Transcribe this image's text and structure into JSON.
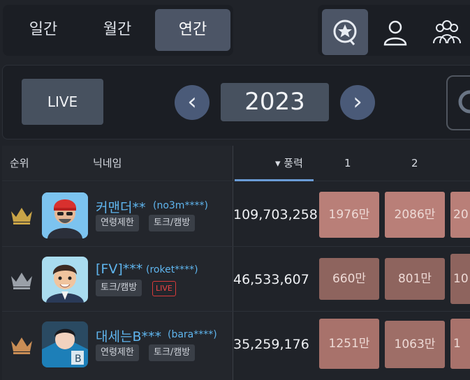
{
  "period_tabs": {
    "daily": "일간",
    "monthly": "월간",
    "yearly": "연간"
  },
  "view_icons": [
    "star-chat-icon",
    "user-icon",
    "group-icon"
  ],
  "controls": {
    "live_label": "LIVE",
    "prev": "‹",
    "year": "2023",
    "next": "›"
  },
  "table": {
    "headers": {
      "rank": "순위",
      "nickname": "닉네임",
      "power": "▾ 풍력",
      "col1": "1",
      "col2": "2"
    },
    "rows": [
      {
        "nickname": "커맨더**",
        "user_id": "(no3m****)",
        "tags": [
          "연령제한",
          "토크/캠방"
        ],
        "live": "",
        "power": "109,703,258",
        "m1": "1976만",
        "m2": "2086만",
        "m3": "20",
        "crown_color": "#c9a447"
      },
      {
        "nickname": "[FV]***",
        "user_id": "(roket****)",
        "tags": [
          "토크/캠방"
        ],
        "live": "LIVE",
        "power": "46,533,607",
        "m1": "660만",
        "m2": "801만",
        "m3": "10",
        "crown_color": "#9aa0a8"
      },
      {
        "nickname": "대세는B***",
        "user_id": "(bara****)",
        "tags": [
          "연령제한",
          "토크/캠방"
        ],
        "live": "",
        "power": "35,259,176",
        "m1": "1251만",
        "m2": "1063만",
        "m3": "1",
        "crown_color": "#c98d55"
      }
    ]
  },
  "colors": {
    "accent": "#6a9bd6",
    "nickname": "#5fb5ee",
    "cell_high": "#b97f78",
    "cell_mid": "#8e645e"
  }
}
